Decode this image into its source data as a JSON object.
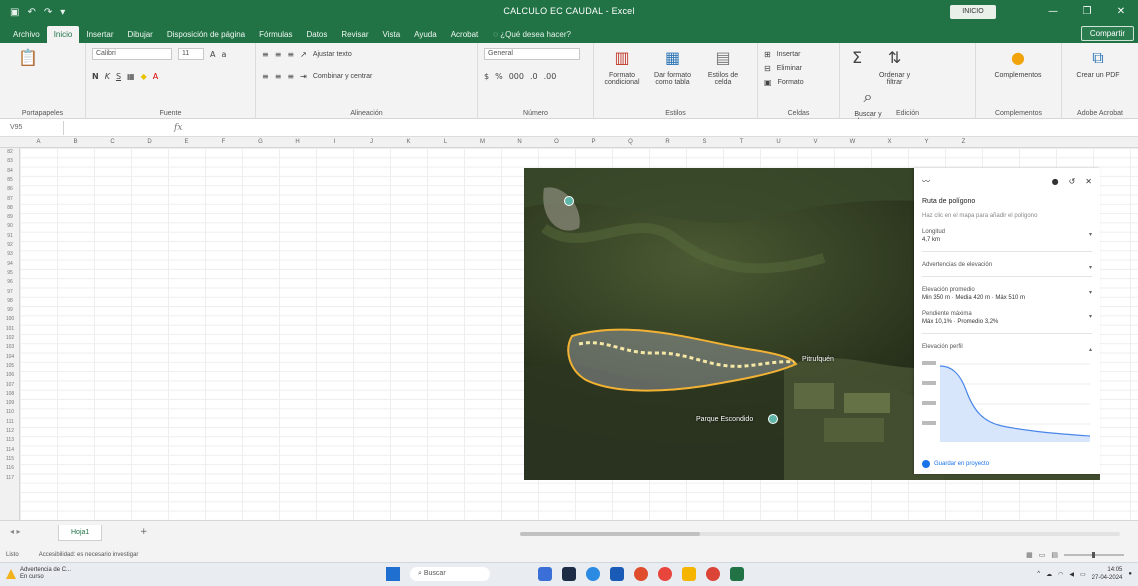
{
  "window": {
    "title": "CALCULO EC CAUDAL - Excel",
    "user_chip": "INICIO",
    "controls": [
      "—",
      "❐",
      "✕"
    ]
  },
  "ribbon": {
    "tabs": [
      "Archivo",
      "Inicio",
      "Insertar",
      "Dibujar",
      "Disposición de página",
      "Fórmulas",
      "Datos",
      "Revisar",
      "Vista",
      "Ayuda",
      "Acrobat"
    ],
    "active_tab": "Inicio",
    "tell_me": "¿Qué desea hacer?",
    "share": "Compartir",
    "font_name": "Calibri",
    "font_size": "11",
    "wrap_text": "Ajustar texto",
    "merge_center": "Combinar y centrar",
    "number_format": "General",
    "groups": {
      "clipboard": "Portapapeles",
      "font": "Fuente",
      "alignment": "Alineación",
      "number": "Número",
      "styles": "Estilos",
      "cells": "Celdas",
      "editing": "Edición",
      "addins": "Complementos",
      "adobe": "Adobe Acrobat"
    },
    "big_buttons": {
      "conditional": "Formato condicional",
      "as_table": "Dar formato como tabla",
      "cell_styles": "Estilos de celda",
      "sort_filter": "Ordenar y filtrar",
      "find_select": "Buscar y seleccionar",
      "addins": "Complementos",
      "create_pdf": "Crear un PDF"
    },
    "cells_items": [
      "Insertar",
      "Eliminar",
      "Formato"
    ]
  },
  "formula_bar": {
    "name_box": "V95",
    "fx": "fx"
  },
  "columns": [
    "A",
    "B",
    "C",
    "D",
    "E",
    "F",
    "G",
    "H",
    "I",
    "J",
    "K",
    "L",
    "M",
    "N",
    "O",
    "P",
    "Q",
    "R",
    "S",
    "T",
    "U",
    "V",
    "W",
    "X",
    "Y",
    "Z"
  ],
  "rows": [
    "82",
    "83",
    "84",
    "85",
    "86",
    "87",
    "88",
    "89",
    "90",
    "91",
    "92",
    "93",
    "94",
    "95",
    "96",
    "97",
    "98",
    "99",
    "100",
    "101",
    "102",
    "103",
    "104",
    "105",
    "106",
    "107",
    "108",
    "109",
    "110",
    "111",
    "112",
    "113",
    "114",
    "115",
    "116",
    "117"
  ],
  "earth": {
    "place_1": "Pitrufquén",
    "place_2": "Parque Escondido"
  },
  "panel": {
    "title": "Ruta de polígono",
    "subtitle": "Haz clic en el mapa para añadir el polígono",
    "fields": [
      {
        "label": "Longitud",
        "value": "4,7 km"
      },
      {
        "label": "Advertencias de elevación",
        "value": ""
      },
      {
        "label": "Elevación promedio",
        "value": "Min 350 m · Media 420 m · Máx 510 m"
      },
      {
        "label": "Pendiente máxima",
        "value": "Máx 10,1% · Promedio 3,2%"
      },
      {
        "label": "Elevación perfil",
        "value": ""
      }
    ],
    "link": "Guardar en proyecto"
  },
  "sheet": {
    "tab": "Hoja1",
    "add": "+"
  },
  "status": {
    "ready": "Listo",
    "accessibility": "Accesibilidad: es necesario investigar"
  },
  "taskbar": {
    "weather_1": "Advertencia de C...",
    "weather_2": "En curso",
    "search": "Buscar",
    "time": "14:05",
    "date": "27-04-2024"
  }
}
